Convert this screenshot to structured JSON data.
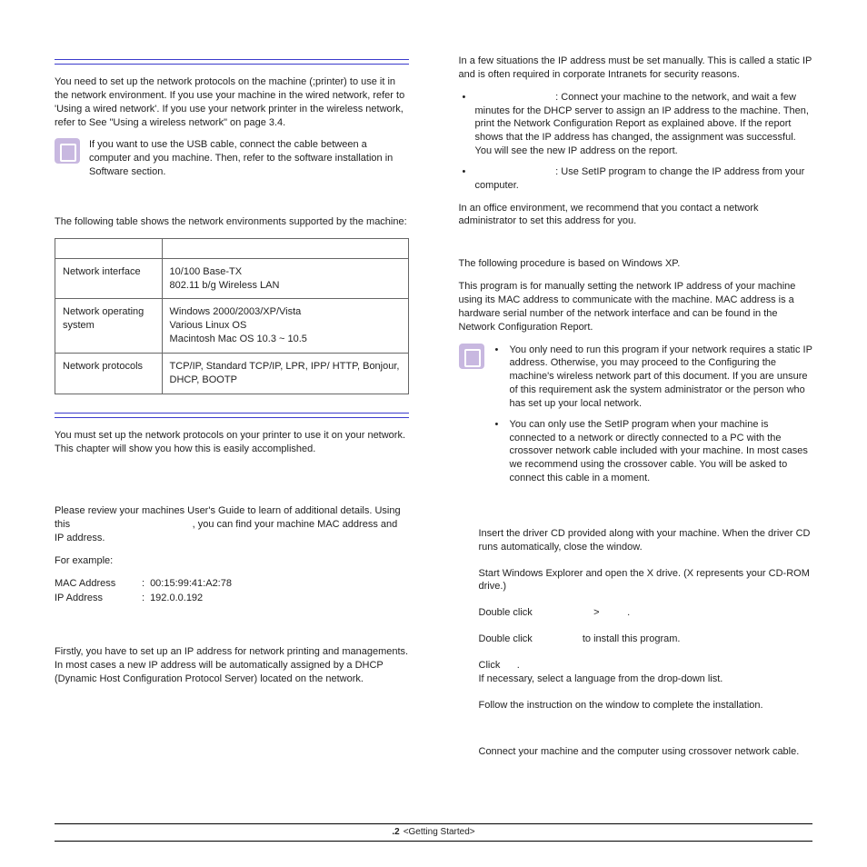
{
  "left": {
    "intro": "You need to set up the network protocols on the machine (;printer) to use it in the network environment. If you use your machine in the wired network, refer to 'Using a wired network'. If you use your network printer in the wireless network, refer to See \"Using a wireless network\" on page 3.4.",
    "note1": "If you want to use the USB cable, connect the cable between a computer and you machine. Then, refer to the software installation in Software section.",
    "table_intro": "The following table shows the network environments supported by the machine:",
    "table": {
      "r1": {
        "k": "Network interface",
        "v1": "10/100 Base-TX",
        "v2": "802.11 b/g Wireless LAN"
      },
      "r2": {
        "k": "Network operating system",
        "v1": "Windows 2000/2003/XP/Vista",
        "v2": "Various Linux OS",
        "v3": "Macintosh Mac OS 10.3 ~ 10.5"
      },
      "r3": {
        "k": "Network protocols",
        "v1": "TCP/IP, Standard TCP/IP, LPR, IPP/ HTTP, Bonjour, DHCP, BOOTP"
      }
    },
    "wired_intro": "You must set up the network protocols on your printer to use it on your network.  This chapter will show you how this is easily accomplished.",
    "review1a": "Please review your machines User's Guide to learn of additional details. Using this ",
    "review1b": ", you can find your machine MAC address and IP address.",
    "for_example": "For example:",
    "mac_lbl": "MAC Address",
    "mac_val": "00:15:99:41:A2:78",
    "ip_lbl": "IP Address",
    "ip_val": "192.0.0.192",
    "dhcp": "Firstly, you have to set up an IP address for network printing and managements. In most cases a new IP address will be automatically assigned by a DHCP (Dynamic Host Configuration Protocol Server) located on the network."
  },
  "right": {
    "static_intro": "In a few situations the IP address must be set manually.  This is called a static IP and is often required in corporate Intranets for security reasons.",
    "b1": ":  Connect your machine to the network, and wait a few minutes for the DHCP server to assign an IP address to the machine. Then, print the Network Configuration Report as explained above. If the report shows that the IP address has changed, the assignment was successful. You will see the new IP address on the report.",
    "b2": ": Use SetIP program to change the IP address from your computer.",
    "office": "In an office environment, we recommend that you contact a network administrator to set this address for you.",
    "proc": "The following procedure is based on Windows XP.",
    "desc": "This program is for manually setting the network IP address of your machine using its MAC address to communicate with the machine. MAC address is a hardware serial number of the network interface and can be found in the Network Configuration Report.",
    "note_b1": "You only need to run this program if your network requires a static IP address. Otherwise, you may proceed to the Configuring the machine's wireless network part of this document. If you are unsure of this requirement ask the system administrator or the person who has set up your local network.",
    "note_b2": "You can only use the SetIP program when your machine is connected to a network or directly connected to a PC with the crossover network cable included with your machine.  In most cases we recommend using the crossover cable. You will be asked to connect this cable in a moment.",
    "s1": "Insert the driver CD provided along with your machine. When the driver CD runs automatically, close the window.",
    "s2": "Start Windows Explorer and open the X drive. (X represents your CD-ROM drive.)",
    "s3a": "Double click",
    "s3b": ">",
    "s3c": ".",
    "s4a": "Double click",
    "s4b": "to install this program.",
    "s5a": "Click",
    "s5b": ".",
    "s5c": "If necessary, select a language from the drop-down list.",
    "s6": "Follow the instruction on the window to complete the installation.",
    "connect": "Connect your machine and the computer using crossover network cable."
  },
  "footer": {
    "pagenum": ".2",
    "label": "<Getting Started>"
  }
}
